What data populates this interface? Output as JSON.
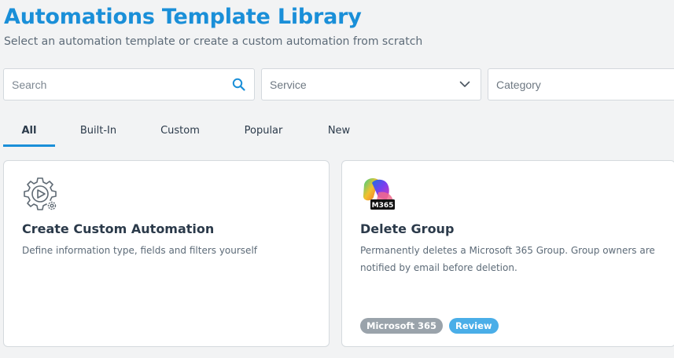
{
  "header": {
    "title": "Automations Template Library",
    "subtitle": "Select an automation template or create a custom automation from scratch"
  },
  "filters": {
    "search_placeholder": "Search",
    "service_placeholder": "Service",
    "category_placeholder": "Category"
  },
  "tabs": [
    {
      "label": "All",
      "active": true
    },
    {
      "label": "Built-In",
      "active": false
    },
    {
      "label": "Custom",
      "active": false
    },
    {
      "label": "Popular",
      "active": false
    },
    {
      "label": "New",
      "active": false
    }
  ],
  "cards": [
    {
      "icon": "gear-play-icon",
      "title": "Create Custom Automation",
      "description": "Define information type, fields and filters yourself",
      "badges": []
    },
    {
      "icon": "m365-logo",
      "logo_text": "M365",
      "title": "Delete Group",
      "description": "Permanently deletes a Microsoft 365 Group. Group owners are notified by email before deletion.",
      "badges": [
        "Microsoft 365",
        "Review"
      ]
    }
  ],
  "colors": {
    "accent": "#1a8fd8",
    "badge_grey": "#9aa3ab",
    "badge_blue": "#4aaee8"
  }
}
